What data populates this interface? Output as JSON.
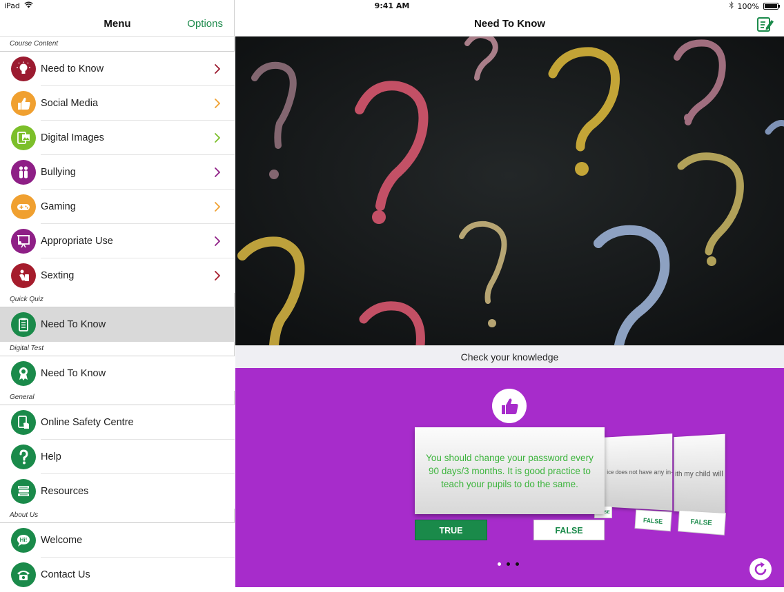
{
  "status_bar": {
    "device": "iPad",
    "time": "9:41 AM",
    "battery": "100%"
  },
  "sidebar": {
    "title": "Menu",
    "options_label": "Options",
    "sections": [
      {
        "header": "Course Content",
        "items": [
          {
            "label": "Need to Know",
            "icon": "lightbulb-icon",
            "color": "#9b1b30",
            "chevron": "#9b1b30"
          },
          {
            "label": "Social Media",
            "icon": "thumbs-up-icon",
            "color": "#f0a030",
            "chevron": "#f0a030"
          },
          {
            "label": "Digital Images",
            "icon": "photo-icon",
            "color": "#7cbf2a",
            "chevron": "#7cbf2a"
          },
          {
            "label": "Bullying",
            "icon": "people-icon",
            "color": "#8e1f86",
            "chevron": "#8e1f86"
          },
          {
            "label": "Gaming",
            "icon": "gamepad-icon",
            "color": "#f0a030",
            "chevron": "#f0a030"
          },
          {
            "label": "Appropriate Use",
            "icon": "presentation-icon",
            "color": "#8e1f86",
            "chevron": "#8e1f86"
          },
          {
            "label": "Sexting",
            "icon": "phone-person-icon",
            "color": "#a51c2c",
            "chevron": "#a51c2c"
          }
        ]
      },
      {
        "header": "Quick Quiz",
        "items": [
          {
            "label": "Need To Know",
            "icon": "clipboard-icon",
            "color": "#1a8a4a",
            "selected": true
          }
        ]
      },
      {
        "header": "Digital Test",
        "items": [
          {
            "label": "Need To Know",
            "icon": "award-icon",
            "color": "#1a8a4a"
          }
        ]
      },
      {
        "header": "General",
        "items": [
          {
            "label": "Online Safety Centre",
            "icon": "tablet-hand-icon",
            "color": "#1a8a4a"
          },
          {
            "label": "Help",
            "icon": "question-icon",
            "color": "#1a8a4a"
          },
          {
            "label": "Resources",
            "icon": "books-icon",
            "color": "#1a8a4a"
          }
        ]
      },
      {
        "header": "About Us",
        "items": [
          {
            "label": "Welcome",
            "icon": "speech-hi-icon",
            "color": "#1a8a4a"
          },
          {
            "label": "Contact Us",
            "icon": "telephone-icon",
            "color": "#1a8a4a"
          }
        ]
      }
    ]
  },
  "main": {
    "title": "Need To Know",
    "check_label": "Check your knowledge",
    "card": {
      "statement": "You should change your password every 90 days/3 months. It is good practice to teach your pupils to do the same.",
      "true_label": "TRUE",
      "false_label": "FALSE",
      "next_card_text": "ice does not have any in-app purchases.",
      "next_card_text_2": "ith my child will to play them.",
      "mini_false": "FALSE",
      "mini_false_2": "FALSE",
      "mini_partial": "FALSE"
    },
    "page_dots": 3,
    "active_dot": 0,
    "colors": {
      "accent": "#1a8a4a",
      "quiz_bg": "#a72ccb",
      "card_text": "#3cb43c"
    }
  }
}
